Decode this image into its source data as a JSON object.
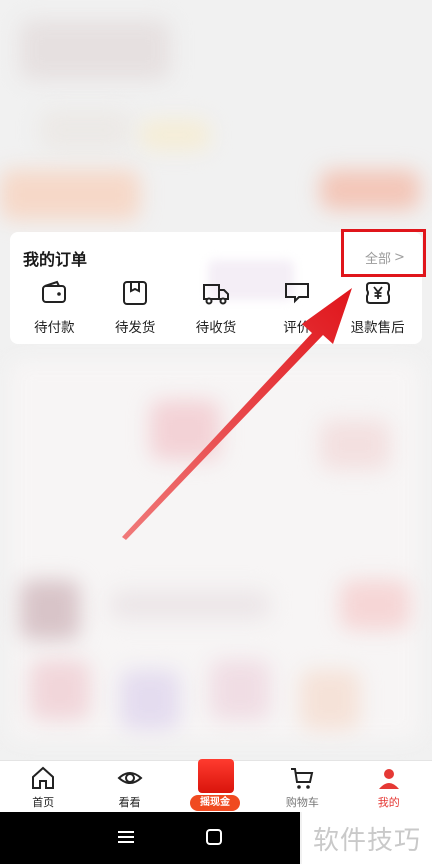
{
  "orders": {
    "title": "我的订单",
    "view_all": "全部",
    "chevron": ">",
    "items": [
      {
        "label": "待付款",
        "icon": "wallet-icon"
      },
      {
        "label": "待发货",
        "icon": "package-icon"
      },
      {
        "label": "待收货",
        "icon": "truck-icon"
      },
      {
        "label": "评价",
        "icon": "review-icon"
      },
      {
        "label": "退款售后",
        "icon": "refund-yen-icon"
      }
    ]
  },
  "tabbar": {
    "tabs": [
      {
        "label": "首页",
        "icon": "home-icon"
      },
      {
        "label": "看看",
        "icon": "eye-icon"
      },
      {
        "label": "",
        "icon": "red-envelope-icon"
      },
      {
        "label": "购物车",
        "icon": "cart-icon"
      },
      {
        "label": "我的",
        "icon": "profile-icon"
      }
    ],
    "promo_badge": "摇现金"
  },
  "watermark": "软件技巧",
  "colors": {
    "accent_red": "#e0151b",
    "brand_red": "#e53935",
    "text_gray": "#9a9a9a"
  }
}
